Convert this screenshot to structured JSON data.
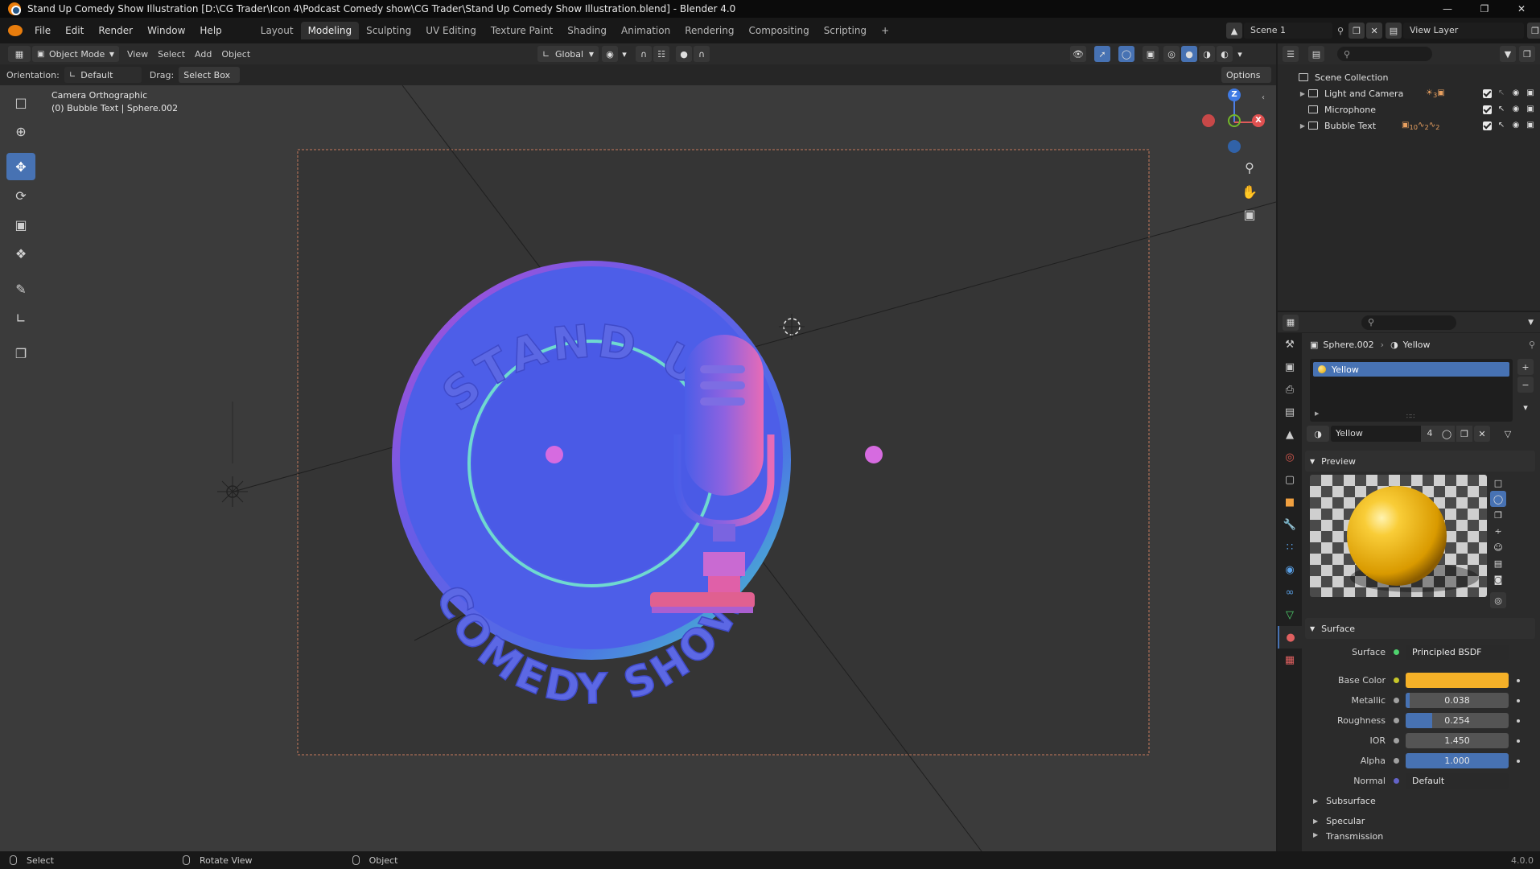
{
  "window": {
    "title": "Stand Up Comedy Show Illustration [D:\\CG Trader\\Icon 4\\Podcast Comedy show\\CG Trader\\Stand Up Comedy Show Illustration.blend] - Blender 4.0",
    "controls": [
      "—",
      "❐",
      "✕"
    ]
  },
  "menubar": {
    "menus": [
      "File",
      "Edit",
      "Render",
      "Window",
      "Help"
    ],
    "workspaces": [
      "Layout",
      "Modeling",
      "Sculpting",
      "UV Editing",
      "Texture Paint",
      "Shading",
      "Animation",
      "Rendering",
      "Compositing",
      "Scripting"
    ],
    "active_workspace": "Modeling",
    "add_tab": "+",
    "scene": "Scene 1",
    "view_layer": "View Layer"
  },
  "viewport_header": {
    "mode": "Object Mode",
    "menus": [
      "View",
      "Select",
      "Add",
      "Object"
    ],
    "transform_orientation": "Global"
  },
  "tool_settings": {
    "orientation_label": "Orientation:",
    "orientation_value": "Default",
    "drag_label": "Drag:",
    "drag_value": "Select Box",
    "options_label": "Options"
  },
  "viewport": {
    "camera_label": "Camera Orthographic",
    "object_label": "(0) Bubble Text | Sphere.002",
    "gizmo_axes": {
      "z": "Z",
      "x": "X"
    },
    "badge": {
      "top_text": "STAND UP",
      "bottom_text": "COMEDY SHOW"
    }
  },
  "toolbar": {
    "tools": [
      "select-box",
      "cursor",
      "move",
      "rotate",
      "scale",
      "transform",
      "annotate",
      "measure",
      "add-cube"
    ],
    "active_tool": "move"
  },
  "outliner": {
    "root": "Scene Collection",
    "items": [
      {
        "label": "Light and Camera",
        "expandable": true
      },
      {
        "label": "Microphone",
        "expandable": false
      },
      {
        "label": "Bubble Text",
        "expandable": true
      }
    ],
    "badge_counts": {
      "light_and_camera": "3",
      "bubble_text_a": "10",
      "bubble_text_b": "2",
      "bubble_text_c": "2"
    }
  },
  "properties": {
    "breadcrumb_object": "Sphere.002",
    "breadcrumb_material": "Yellow",
    "slots": [
      {
        "label": "Yellow",
        "selected": true
      }
    ],
    "material_name": "Yellow",
    "material_users": "4",
    "preview_label": "Preview",
    "surface_panel_label": "Surface",
    "surface": {
      "label": "Surface",
      "shader": "Principled BSDF"
    },
    "fields": {
      "base_color": {
        "label": "Base Color",
        "color": "#f5b128"
      },
      "metallic": {
        "label": "Metallic",
        "value": "0.038",
        "fraction": 0.038
      },
      "roughness": {
        "label": "Roughness",
        "value": "0.254",
        "fraction": 0.254
      },
      "ior": {
        "label": "IOR",
        "value": "1.450",
        "fraction": 0
      },
      "alpha": {
        "label": "Alpha",
        "value": "1.000",
        "fraction": 1.0
      },
      "normal": {
        "label": "Normal",
        "value": "Default"
      }
    },
    "subpanels": [
      "Subsurface",
      "Specular",
      "Transmission"
    ]
  },
  "statusbar": {
    "select": "Select",
    "rotate": "Rotate View",
    "object": "Object",
    "version": "4.0.0"
  },
  "colors": {
    "accent": "#4772b3",
    "base_color": "#f5b128",
    "badge_blue": "#4d5ee8"
  }
}
